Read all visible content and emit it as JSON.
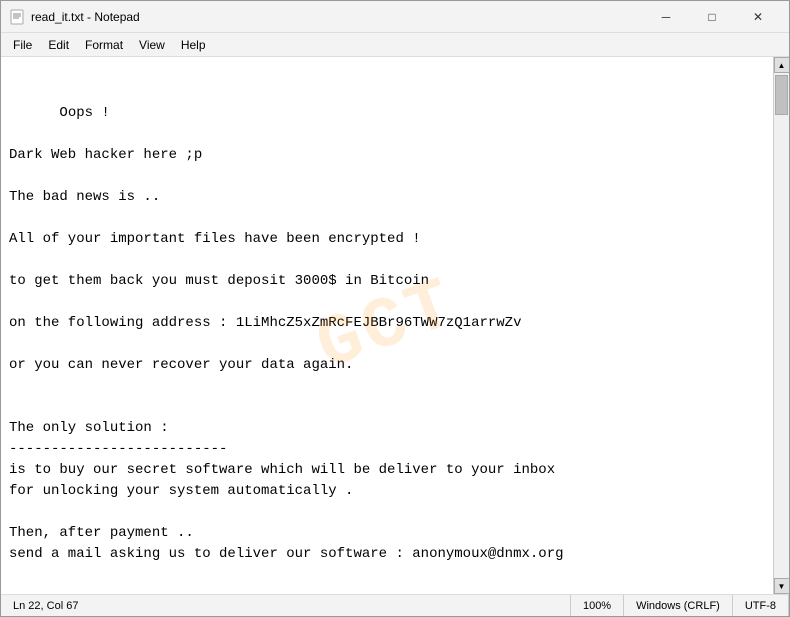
{
  "window": {
    "title": "read_it.txt - Notepad",
    "icon": "📄"
  },
  "titlebar": {
    "minimize_label": "─",
    "maximize_label": "□",
    "close_label": "✕"
  },
  "menubar": {
    "items": [
      "File",
      "Edit",
      "Format",
      "View",
      "Help"
    ]
  },
  "content": {
    "text": "Oops !\n\nDark Web hacker here ;p\n\nThe bad news is ..\n\nAll of your important files have been encrypted !\n\nto get them back you must deposit 3000$ in Bitcoin\n\non the following address : 1LiMhcZ5xZmRcFEJBBr96TWW7zQ1arrwZv\n\nor you can never recover your data again.\n\n\nThe only solution :\n--------------------------\nis to buy our secret software which will be deliver to your inbox\nfor unlocking your system automatically .\n\nThen, after payment ..\nsend a mail asking us to deliver our software : anonymoux@dnmx.org",
    "watermark": "GCT"
  },
  "statusbar": {
    "line_col": "Ln 22, Col 67",
    "zoom": "100%",
    "line_ending": "Windows (CRLF)",
    "encoding": "UTF-8"
  }
}
